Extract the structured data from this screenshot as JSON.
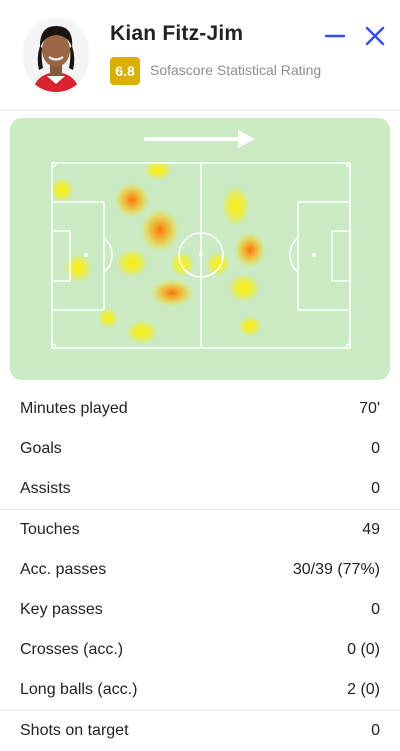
{
  "header": {
    "player_name": "Kian Fitz-Jim",
    "rating": "6.8",
    "rating_label": "Sofascore Statistical Rating",
    "colors": {
      "rating_badge": "#d9af00",
      "icon_accent": "#374df5"
    }
  },
  "heatmap": {
    "direction": "attack-right",
    "colors": {
      "pitch": "#c9eac3",
      "lines": "#ffffff"
    }
  },
  "stats": {
    "group1": [
      {
        "label": "Minutes played",
        "value": "70'"
      },
      {
        "label": "Goals",
        "value": "0"
      },
      {
        "label": "Assists",
        "value": "0"
      }
    ],
    "group2": [
      {
        "label": "Touches",
        "value": "49"
      },
      {
        "label": "Acc. passes",
        "value": "30/39 (77%)"
      },
      {
        "label": "Key passes",
        "value": "0"
      },
      {
        "label": "Crosses (acc.)",
        "value": "0 (0)"
      },
      {
        "label": "Long balls (acc.)",
        "value": "2 (0)"
      }
    ],
    "group3": [
      {
        "label": "Shots on target",
        "value": "0"
      }
    ]
  }
}
